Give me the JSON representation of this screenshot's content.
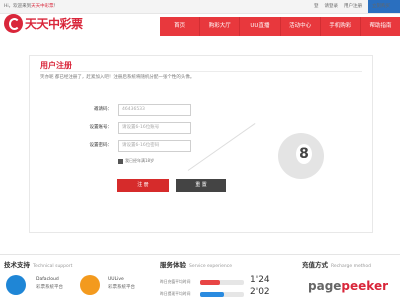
{
  "topbar": {
    "welcome_prefix": "Hi，欢迎来到",
    "welcome_brand": "天天中彩票",
    "welcome_suffix": "！",
    "login": "登",
    "register_link": "请登录",
    "user_register": "用户注册",
    "ws_button": "立刻购买"
  },
  "header": {
    "logo_text": "天天中彩票",
    "nav": [
      "首页",
      "购彩大厅",
      "UU直播",
      "活动中心",
      "手机购彩",
      "帮助指南"
    ]
  },
  "register": {
    "title": "用户注册",
    "intro": "笑亦呢 都已经注册了，赶紧加入吧！注册后系统将随机分配一张个性的头像。",
    "fields": [
      {
        "label": "邀请码：",
        "placeholder": "46436533"
      },
      {
        "label": "设置账号：",
        "placeholder": "请设置6-16位账号"
      },
      {
        "label": "设置密码：",
        "placeholder": "请设置6-16位密码"
      }
    ],
    "agree": "我已经年满18岁",
    "register_button": "注 册",
    "reset_button": "重 置",
    "ball_number": "8"
  },
  "footer": {
    "tech": {
      "title": "技术支持",
      "en": "Technical support"
    },
    "dafacloud": {
      "name": "Dafacloud",
      "sub": "彩票系统平台"
    },
    "uulive": {
      "name": "UULive",
      "sub": "彩票系统平台"
    },
    "service": {
      "title": "服务体验",
      "en": "Service experience"
    },
    "deposit_label": "昨日充值平均时间",
    "deposit_time": "1'24",
    "deposit_level": 0.45,
    "withdraw_label": "昨日提现平均时间",
    "withdraw_time": "2'02",
    "withdraw_level": 0.55,
    "recharge": {
      "title": "充值方式",
      "en": "Recharge method"
    }
  },
  "watermark": {
    "page": "page",
    "peeker": "peeker"
  }
}
